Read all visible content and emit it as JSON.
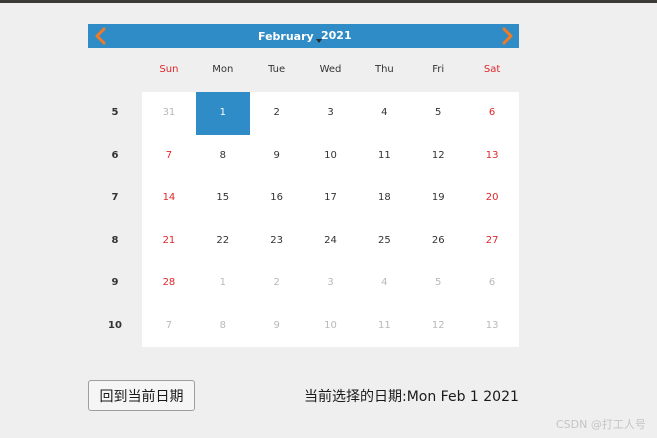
{
  "colors": {
    "header_bg": "#308cc6",
    "selected_bg": "#308cc6",
    "weekend_text": "#e0262a",
    "other_month_text": "#b9b9b9",
    "nav_arrow": "#f07b22"
  },
  "calendar": {
    "month": "February",
    "year": "2021",
    "prev_icon": "chevron-left-icon",
    "next_icon": "chevron-right-icon",
    "weekdays": [
      "Sun",
      "Mon",
      "Tue",
      "Wed",
      "Thu",
      "Fri",
      "Sat"
    ],
    "week_numbers": [
      "5",
      "6",
      "7",
      "8",
      "9",
      "10"
    ],
    "weeks": [
      [
        "31",
        "1",
        "2",
        "3",
        "4",
        "5",
        "6"
      ],
      [
        "7",
        "8",
        "9",
        "10",
        "11",
        "12",
        "13"
      ],
      [
        "14",
        "15",
        "16",
        "17",
        "18",
        "19",
        "20"
      ],
      [
        "21",
        "22",
        "23",
        "24",
        "25",
        "26",
        "27"
      ],
      [
        "28",
        "1",
        "2",
        "3",
        "4",
        "5",
        "6"
      ],
      [
        "7",
        "8",
        "9",
        "10",
        "11",
        "12",
        "13"
      ]
    ],
    "selected_day": "1"
  },
  "controls": {
    "today_button_label": "回到当前日期",
    "selected_date_text": "当前选择的日期:Mon Feb 1 2021"
  },
  "watermark": "CSDN @打工人号"
}
